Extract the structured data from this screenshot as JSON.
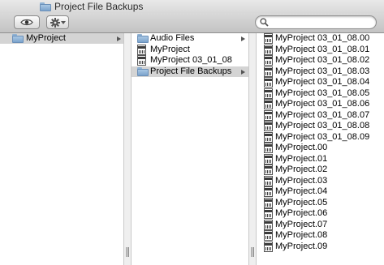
{
  "window": {
    "title": "Project File Backups"
  },
  "toolbar": {
    "search_placeholder": ""
  },
  "column1": {
    "items": [
      {
        "label": "MyProject",
        "kind": "folder",
        "selected": true,
        "has_children": true
      }
    ]
  },
  "column2": {
    "items": [
      {
        "label": "Audio Files",
        "kind": "folder",
        "selected": false,
        "has_children": true
      },
      {
        "label": "MyProject",
        "kind": "document",
        "selected": false,
        "has_children": false
      },
      {
        "label": "MyProject 03_01_08",
        "kind": "document",
        "selected": false,
        "has_children": false
      },
      {
        "label": "Project File Backups",
        "kind": "folder",
        "selected": true,
        "has_children": true
      }
    ]
  },
  "column3": {
    "items": [
      {
        "label": "MyProject 03_01_08.00",
        "kind": "document"
      },
      {
        "label": "MyProject 03_01_08.01",
        "kind": "document"
      },
      {
        "label": "MyProject 03_01_08.02",
        "kind": "document"
      },
      {
        "label": "MyProject 03_01_08.03",
        "kind": "document"
      },
      {
        "label": "MyProject 03_01_08.04",
        "kind": "document"
      },
      {
        "label": "MyProject 03_01_08.05",
        "kind": "document"
      },
      {
        "label": "MyProject 03_01_08.06",
        "kind": "document"
      },
      {
        "label": "MyProject 03_01_08.07",
        "kind": "document"
      },
      {
        "label": "MyProject 03_01_08.08",
        "kind": "document"
      },
      {
        "label": "MyProject 03_01_08.09",
        "kind": "document"
      },
      {
        "label": "MyProject.00",
        "kind": "document"
      },
      {
        "label": "MyProject.01",
        "kind": "document"
      },
      {
        "label": "MyProject.02",
        "kind": "document"
      },
      {
        "label": "MyProject.03",
        "kind": "document"
      },
      {
        "label": "MyProject.04",
        "kind": "document"
      },
      {
        "label": "MyProject.05",
        "kind": "document"
      },
      {
        "label": "MyProject.06",
        "kind": "document"
      },
      {
        "label": "MyProject.07",
        "kind": "document"
      },
      {
        "label": "MyProject.08",
        "kind": "document"
      },
      {
        "label": "MyProject.09",
        "kind": "document"
      }
    ]
  },
  "icons": {
    "title_icon": "folder-icon",
    "view_button": "eye-icon",
    "action_button": "gear-icon",
    "search": "search-icon"
  },
  "colors": {
    "selection": "#d4d4d4",
    "folder": "#8fb2d4"
  }
}
